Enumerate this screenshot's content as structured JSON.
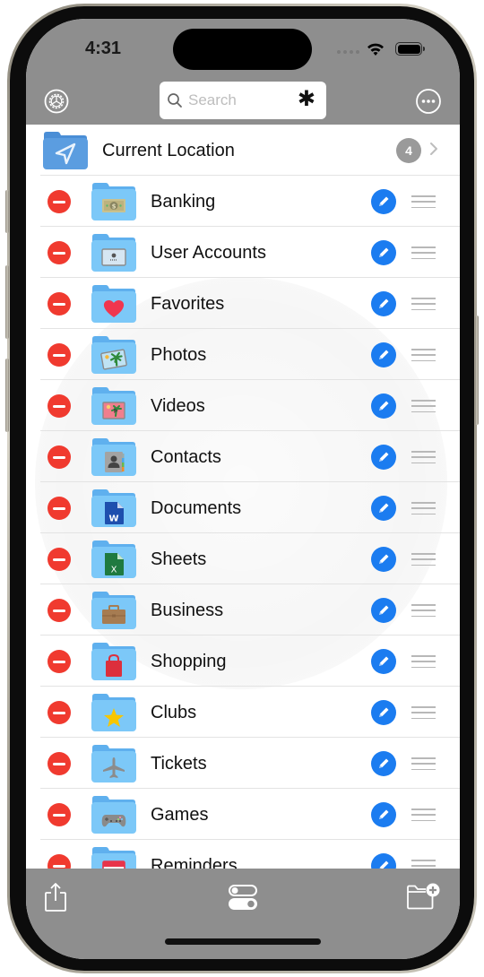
{
  "status_bar": {
    "time": "4:31"
  },
  "header": {
    "settings_icon": "gear-circle-icon",
    "search": {
      "placeholder": "Search",
      "value": ""
    },
    "search_accessory": "✱",
    "more_icon": "ellipsis-circle-icon"
  },
  "current_location": {
    "label": "Current Location",
    "badge_count": "4",
    "icon": "location-arrow-folder-icon"
  },
  "folders": [
    {
      "label": "Banking",
      "icon": "banknote"
    },
    {
      "label": "User Accounts",
      "icon": "id-card"
    },
    {
      "label": "Favorites",
      "icon": "heart"
    },
    {
      "label": "Photos",
      "icon": "photo"
    },
    {
      "label": "Videos",
      "icon": "video"
    },
    {
      "label": "Contacts",
      "icon": "contacts"
    },
    {
      "label": "Documents",
      "icon": "word-doc"
    },
    {
      "label": "Sheets",
      "icon": "excel-sheet"
    },
    {
      "label": "Business",
      "icon": "briefcase"
    },
    {
      "label": "Shopping",
      "icon": "shopping-bag"
    },
    {
      "label": "Clubs",
      "icon": "star"
    },
    {
      "label": "Tickets",
      "icon": "airplane"
    },
    {
      "label": "Games",
      "icon": "gamepad"
    },
    {
      "label": "Reminders",
      "icon": "calendar"
    }
  ],
  "colors": {
    "delete": "#f03a2f",
    "edit": "#1b7cf0",
    "folder": "#7cc8f8",
    "folder_tab": "#5fb0ee",
    "location_folder": "#5b9de0",
    "toolbar": "#8e8e8e"
  },
  "toolbar": {
    "share_icon": "share-icon",
    "toggles_icon": "toggles-icon",
    "new_folder_icon": "folder-plus-icon"
  }
}
